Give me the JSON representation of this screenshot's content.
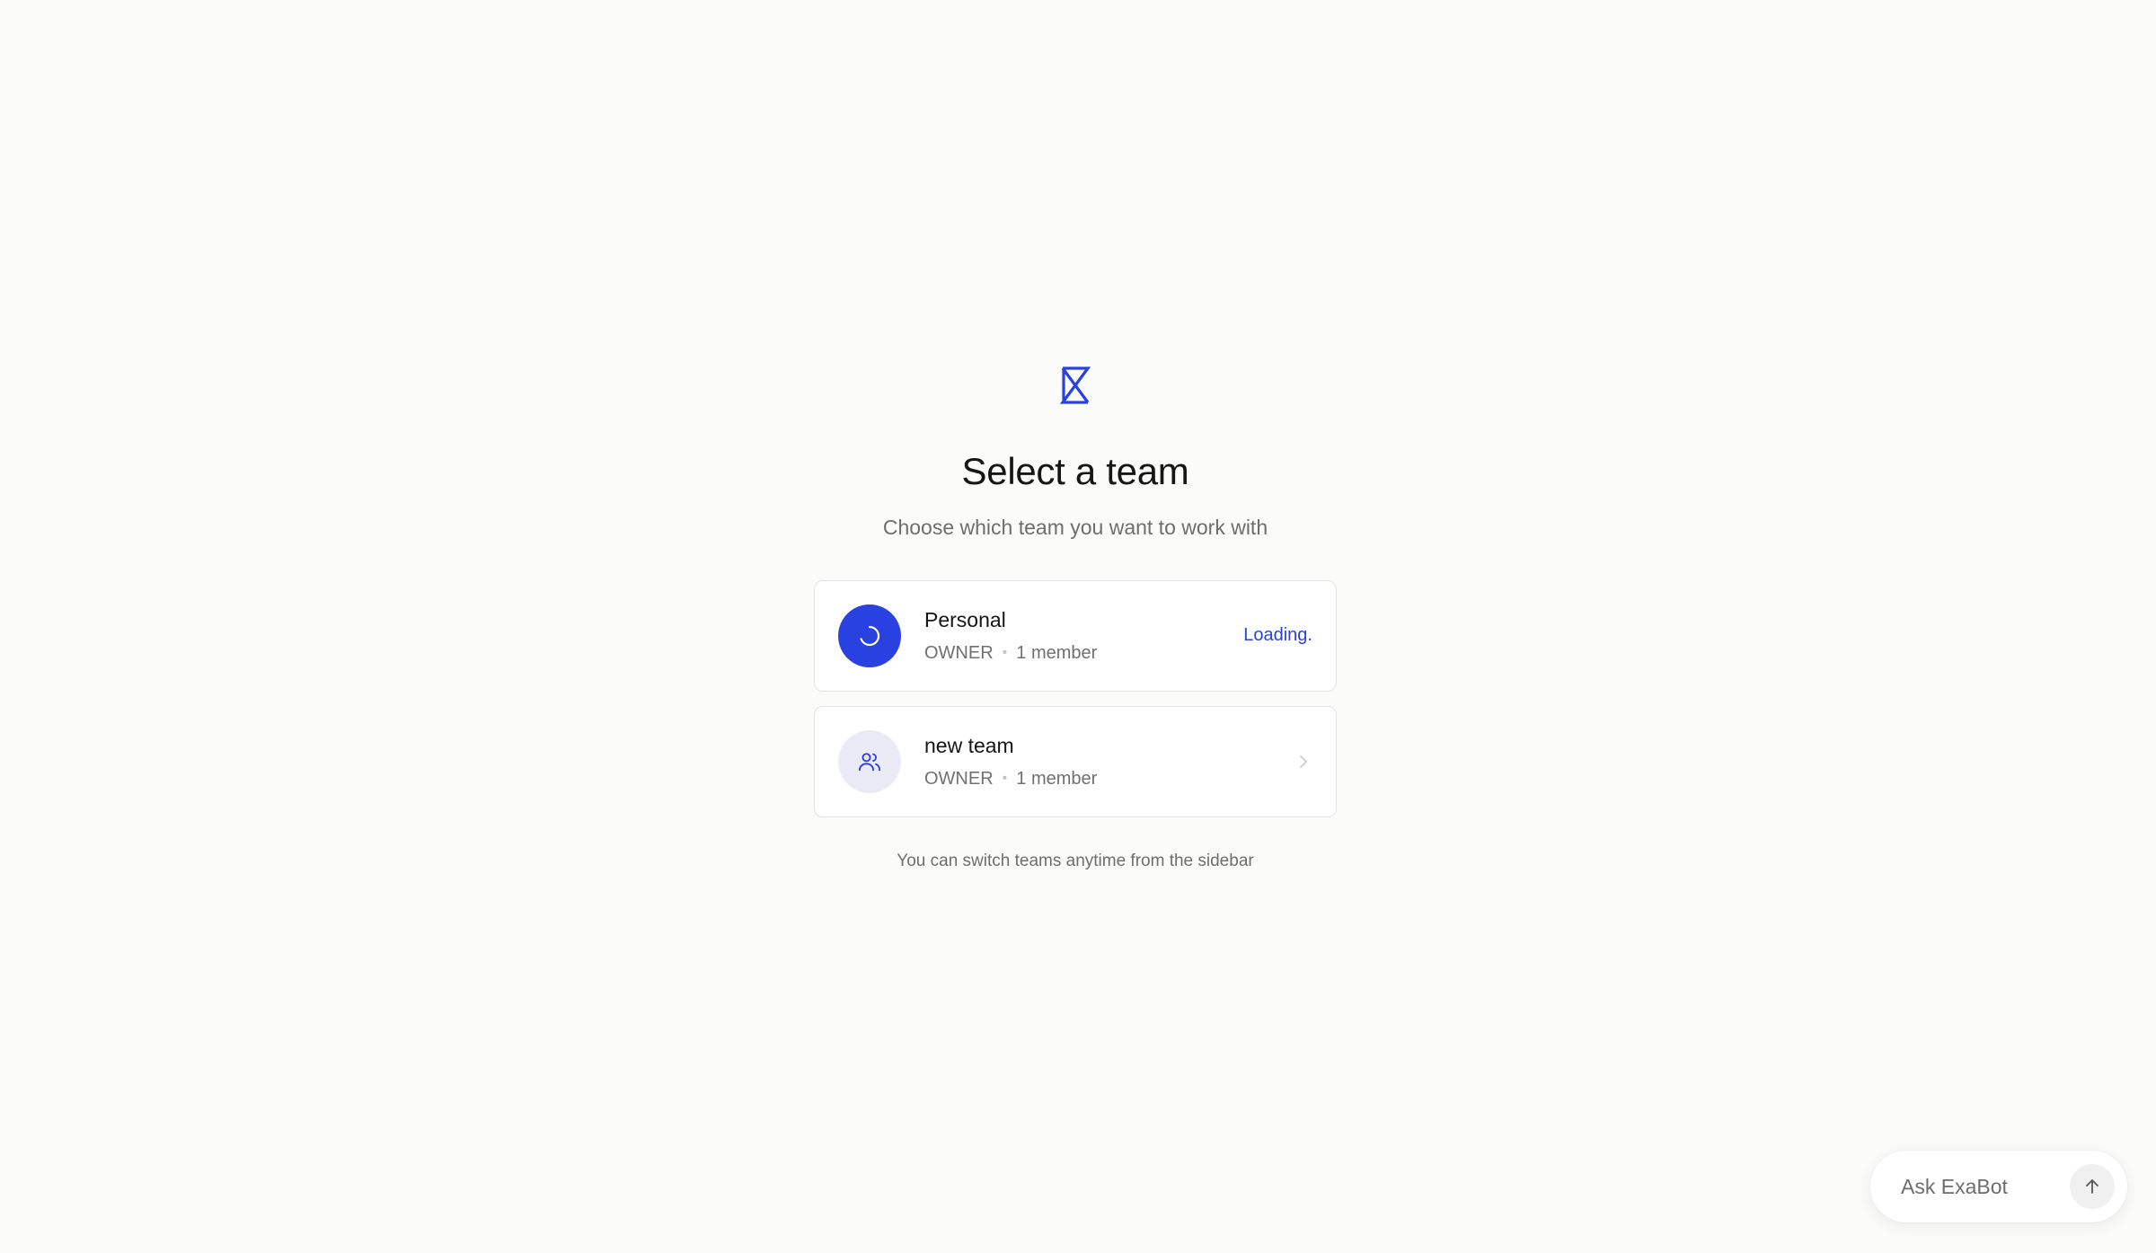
{
  "header": {
    "logo_icon": "exa-hourglass-logo-icon",
    "title": "Select a team",
    "subtitle": "Choose which team you want to work with"
  },
  "teams": [
    {
      "name": "Personal",
      "role": "OWNER",
      "members": "1 member",
      "status": "Loading.",
      "icon": "spinner-icon"
    },
    {
      "name": "new team",
      "role": "OWNER",
      "members": "1 member",
      "icon": "users-icon",
      "action_icon": "chevron-right-icon"
    }
  ],
  "footnote": "You can switch teams anytime from the sidebar",
  "exabot": {
    "placeholder": "Ask ExaBot",
    "send_icon": "arrow-up-icon"
  },
  "colors": {
    "accent": "#2941e0",
    "background": "#fbfbfa",
    "muted_avatar": "#ebebf7"
  }
}
